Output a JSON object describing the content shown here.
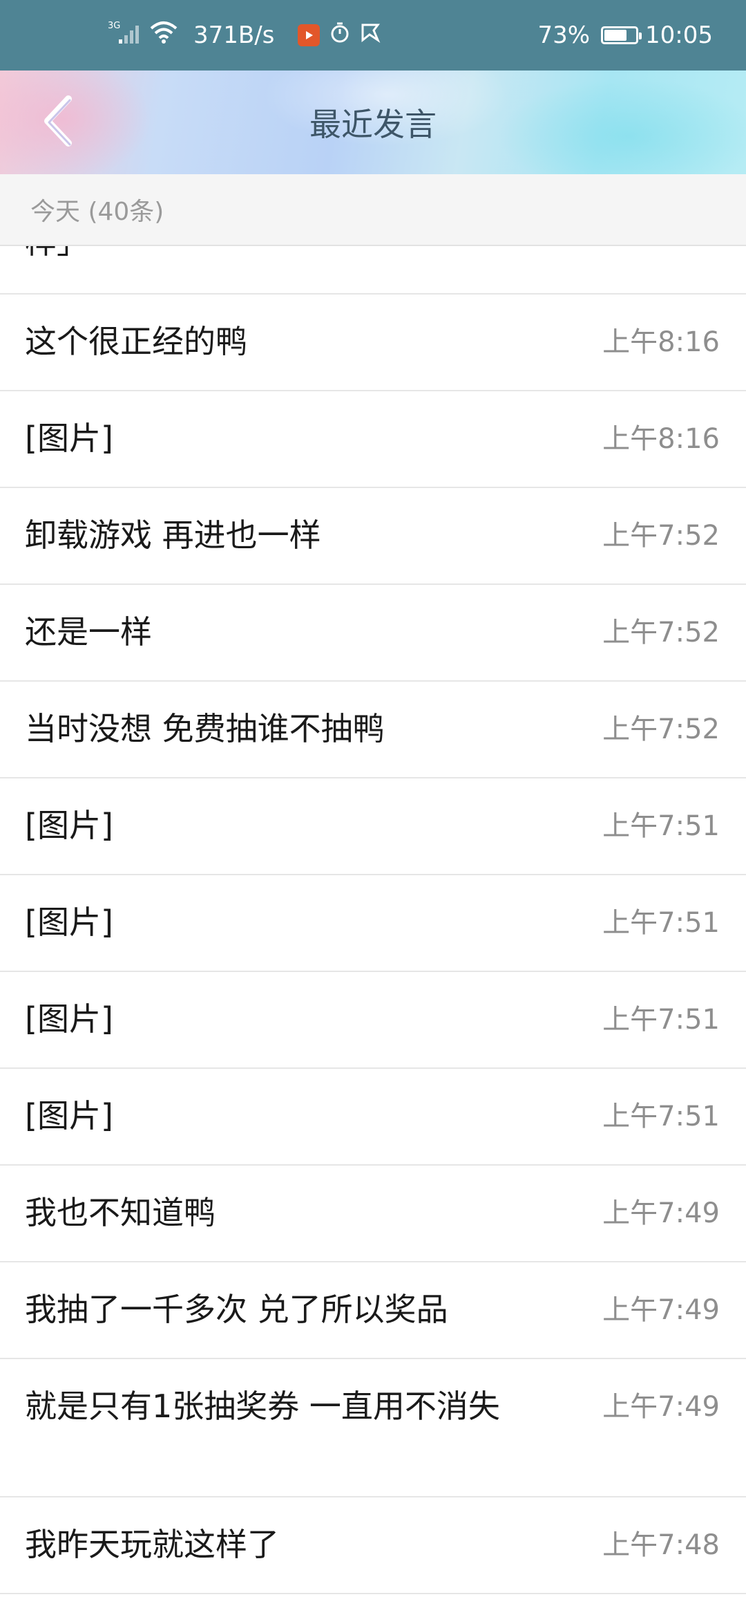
{
  "status_bar": {
    "network": "3G",
    "speed": "371B/s",
    "battery_percent": "73%",
    "battery_level": 0.73,
    "time": "10:05"
  },
  "header": {
    "title": "最近发言",
    "back_icon": "chevron-left-icon"
  },
  "section": {
    "label": "今天 (40条)"
  },
  "messages": [
    {
      "text": "样」",
      "time": ""
    },
    {
      "text": "这个很正经的鸭",
      "time": "上午8:16"
    },
    {
      "text": "[图片]",
      "time": "上午8:16"
    },
    {
      "text": "卸载游戏 再进也一样",
      "time": "上午7:52"
    },
    {
      "text": "还是一样",
      "time": "上午7:52"
    },
    {
      "text": "当时没想  免费抽谁不抽鸭",
      "time": "上午7:52"
    },
    {
      "text": "[图片]",
      "time": "上午7:51"
    },
    {
      "text": "[图片]",
      "time": "上午7:51"
    },
    {
      "text": "[图片]",
      "time": "上午7:51"
    },
    {
      "text": "[图片]",
      "time": "上午7:51"
    },
    {
      "text": "我也不知道鸭",
      "time": "上午7:49"
    },
    {
      "text": "我抽了一千多次  兑了所以奖品",
      "time": "上午7:49"
    },
    {
      "text": "就是只有1张抽奖券  一直用不消失",
      "time": "上午7:49"
    },
    {
      "text": "我昨天玩就这样了",
      "time": "上午7:48"
    }
  ],
  "colors": {
    "status_bar_bg": "#4f8494",
    "section_bg": "#f5f5f5",
    "time_text": "#8e8e8e",
    "back_arrow": "#ffffff"
  }
}
